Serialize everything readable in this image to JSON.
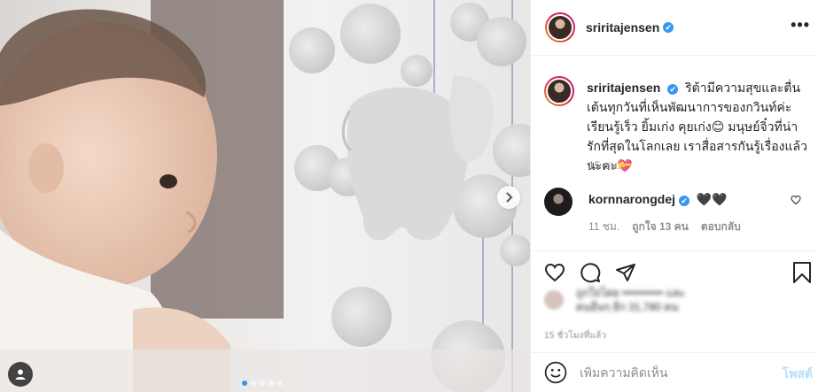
{
  "post": {
    "username": "sriritajensen",
    "verified_mark": "✔",
    "more_icon": "•••",
    "caption": "ริต้ามีความสุขและตื่นเต้นทุกวันที่เห็นพัฒนาการของกวินท์ค่ะ เรียนรู้เร็ว ยิ้มเก่ง คุยเก่ง😊 มนุษย์จิ๋วที่น่ารักที่สุดในโลกเลย เราสื่อสารกันรู้เรื่องแล้วนะคะ💝",
    "caption_time": "15 ชม."
  },
  "comment": {
    "username": "kornnarongdej",
    "text": "🖤🖤",
    "time": "11 ชม.",
    "likes": "ถูกใจ 13 คน",
    "reply": "ตอบกลับ"
  },
  "likes": {
    "line1": "ถูกใจโดย ••••••••••• และ",
    "line2": "คนอื่นๆ อีก 31,780 คน"
  },
  "post_time": "15 ชั่วโมงที่แล้ว",
  "add_comment": {
    "placeholder": "เพิ่มความคิดเห็น",
    "post_label": "โพสต์"
  },
  "carousel": {
    "slide_count": 5,
    "active_index": 0,
    "accent": "#3897f0"
  },
  "icons": [
    "chevron-right-icon",
    "user-tag-icon",
    "heart-icon",
    "comment-icon",
    "share-icon",
    "bookmark-icon",
    "smile-icon",
    "verified-icon",
    "more-icon"
  ]
}
